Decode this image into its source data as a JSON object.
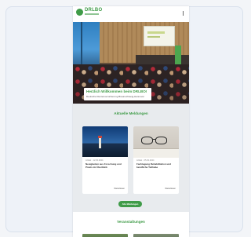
{
  "header": {
    "logo_text": "DRLBO",
    "logo_icon": "logo-circle-icon",
    "menu_icon": "vertical-dots-menu-icon"
  },
  "hero": {
    "welcome_title": "Herzlich Willkommen beim DRLBO!",
    "welcome_subtitle": "Deutsche Rentenversicherung Braunschweig-Hannover"
  },
  "news": {
    "section_title": "Aktuelle Meldungen",
    "cards": [
      {
        "meta": "Artikel · 12.03.2024",
        "headline": "Neuigkeiten aus Forschung und Praxis im Überblick",
        "more_label": "Weiterlesen",
        "image_icon": "lighthouse-image"
      },
      {
        "meta": "Artikel · 05.03.2024",
        "headline": "Fachtagung Rehabilitation und berufliche Teilhabe",
        "more_label": "Weiterlesen",
        "image_icon": "glasses-image"
      }
    ],
    "all_button_label": "Alle Meldungen"
  },
  "section2": {
    "title": "Veranstaltungen"
  },
  "colors": {
    "accent_green": "#3f9b48",
    "page_bg": "#f3f5f8",
    "news_bg": "#e8ebee"
  }
}
